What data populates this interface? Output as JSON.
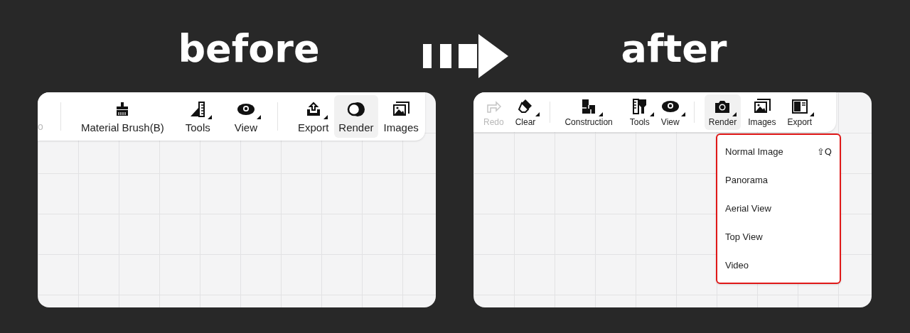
{
  "panels": [
    {
      "title": "before",
      "toolbar": {
        "leading_text": "o",
        "items": [
          {
            "kind": "separator"
          },
          {
            "kind": "tool",
            "label": "Material Brush(B)",
            "selected": false,
            "disabled": false,
            "caret": false
          },
          {
            "kind": "tool",
            "label": "Tools",
            "selected": false,
            "disabled": false,
            "caret": true
          },
          {
            "kind": "tool",
            "label": "View",
            "selected": false,
            "disabled": false,
            "caret": true
          },
          {
            "kind": "separator"
          },
          {
            "kind": "tool",
            "label": "Export",
            "selected": false,
            "disabled": false,
            "caret": true
          },
          {
            "kind": "tool",
            "label": "Render",
            "selected": true,
            "disabled": false,
            "caret": false
          },
          {
            "kind": "tool",
            "label": "Images",
            "selected": false,
            "disabled": false,
            "caret": false
          }
        ]
      }
    },
    {
      "title": "after",
      "toolbar": {
        "items": [
          {
            "kind": "tool",
            "label": "Redo",
            "selected": false,
            "disabled": true,
            "caret": false
          },
          {
            "kind": "tool",
            "label": "Clear",
            "selected": false,
            "disabled": false,
            "caret": true
          },
          {
            "kind": "separator"
          },
          {
            "kind": "tool",
            "label": "Construction",
            "selected": false,
            "disabled": false,
            "caret": true
          },
          {
            "kind": "tool",
            "label": "Tools",
            "selected": false,
            "disabled": false,
            "caret": true
          },
          {
            "kind": "tool",
            "label": "View",
            "selected": false,
            "disabled": false,
            "caret": true
          },
          {
            "kind": "separator"
          },
          {
            "kind": "tool",
            "label": "Render",
            "selected": true,
            "disabled": false,
            "caret": true
          },
          {
            "kind": "tool",
            "label": "Images",
            "selected": false,
            "disabled": false,
            "caret": false
          },
          {
            "kind": "tool",
            "label": "Export",
            "selected": false,
            "disabled": false,
            "caret": true
          }
        ]
      },
      "menu": {
        "items": [
          {
            "label": "Normal Image",
            "shortcut": "⇧Q"
          },
          {
            "label": "Panorama"
          },
          {
            "label": "Aerial View"
          },
          {
            "label": "Top View"
          },
          {
            "label": "Video"
          }
        ]
      }
    }
  ]
}
